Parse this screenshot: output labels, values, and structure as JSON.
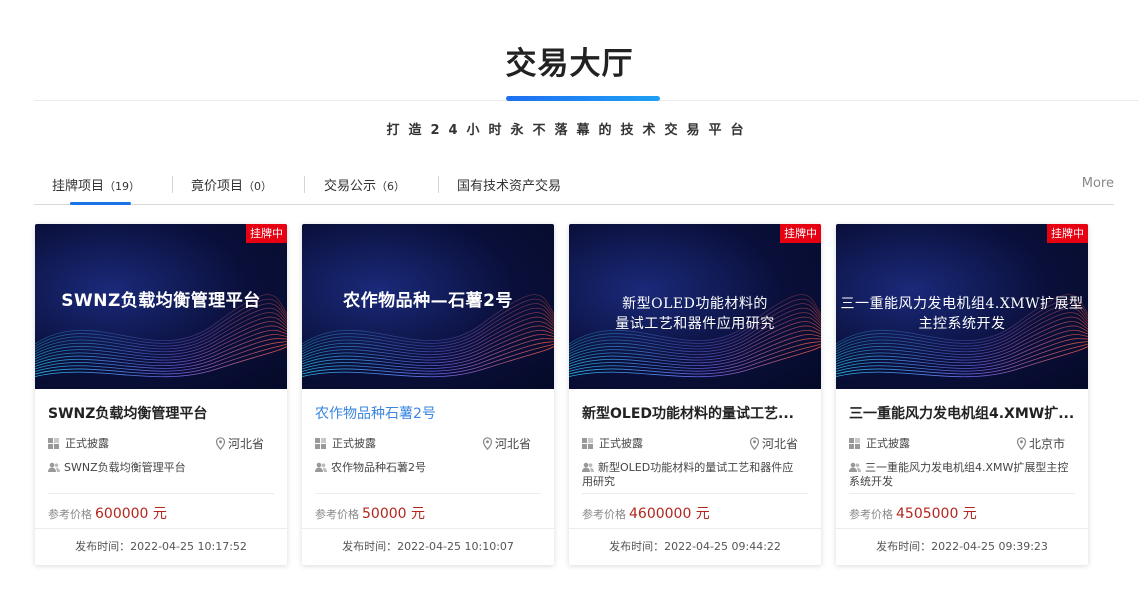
{
  "page": {
    "title": "交易大厅",
    "subtitle": "打造24小时永不落幕的技术交易平台"
  },
  "tabs": {
    "items": [
      {
        "label": "挂牌项目",
        "count": "（19）"
      },
      {
        "label": "竟价项目",
        "count": "（0）"
      },
      {
        "label": "交易公示",
        "count": "（6）"
      },
      {
        "label": "国有技术资产交易",
        "count": ""
      }
    ],
    "more": "More",
    "active_color": "#1a73e8"
  },
  "cards": [
    {
      "image_text": "SWNZ负载均衡管理平台",
      "image_text_2": "",
      "badge": "挂牌中",
      "title": "SWNZ负载均衡管理平台",
      "disclosure": "正式披露",
      "location": "河北省",
      "description": "SWNZ负载均衡管理平台",
      "price_label": "参考价格",
      "price": "600000 元",
      "publish_time": "发布时间：2022-04-25 10:17:52"
    },
    {
      "image_text": "农作物品种—石薯2号",
      "image_text_2": "",
      "badge": "",
      "title": "农作物品种石薯2号",
      "disclosure": "正式披露",
      "location": "河北省",
      "description": "农作物品种石薯2号",
      "price_label": "参考价格",
      "price": "50000 元",
      "publish_time": "发布时间：2022-04-25 10:10:07"
    },
    {
      "image_text": "新型OLED功能材料的",
      "image_text_2": "量试工艺和器件应用研究",
      "badge": "挂牌中",
      "title": "新型OLED功能材料的量试工艺...",
      "disclosure": "正式披露",
      "location": "河北省",
      "description": "新型OLED功能材料的量试工艺和器件应用研究",
      "price_label": "参考价格",
      "price": "4600000 元",
      "publish_time": "发布时间：2022-04-25 09:44:22"
    },
    {
      "image_text": "三一重能风力发电机组4.XMW扩展型",
      "image_text_2": "主控系统开发",
      "badge": "挂牌中",
      "title": "三一重能风力发电机组4.XMW扩...",
      "disclosure": "正式披露",
      "location": "北京市",
      "description": "三一重能风力发电机组4.XMW扩展型主控系统开发",
      "price_label": "参考价格",
      "price": "4505000 元",
      "publish_time": "发布时间：2022-04-25 09:39:23"
    }
  ],
  "colors": {
    "badge": "#e60012",
    "price": "#b3261e",
    "link_title": "#3b86e0"
  }
}
